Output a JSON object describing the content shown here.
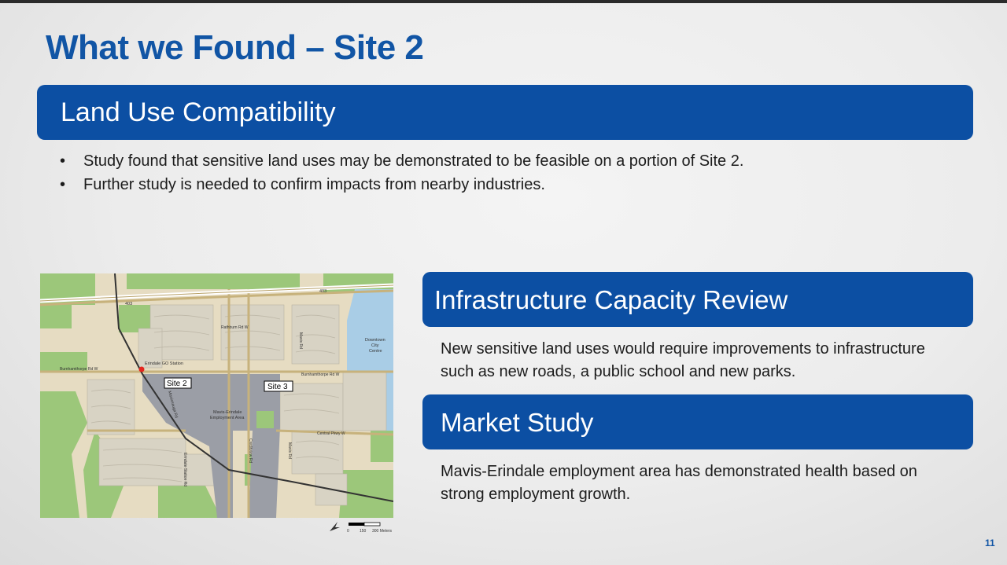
{
  "slide": {
    "title": "What we Found – Site 2",
    "page_number": "11"
  },
  "land_use": {
    "heading": "Land Use Compatibility",
    "bullets": [
      "Study found that sensitive land uses may be demonstrated to be feasible on a portion of Site 2.",
      "Further study is needed to confirm impacts from nearby industries."
    ]
  },
  "infrastructure": {
    "heading": "Infrastructure Capacity Review",
    "text": "New sensitive land uses would require improvements to infrastructure such as new roads, a public school and new parks."
  },
  "market": {
    "heading": "Market Study",
    "text": "Mavis-Erindale employment area has demonstrated health based on strong employment growth."
  },
  "map": {
    "labels": {
      "site2": "Site 2",
      "site3": "Site 3",
      "station": "Erindale GO Station",
      "employment_line1": "Mavis-Erindale",
      "employment_line2": "Employment Area",
      "downtown_line1": "Downtown",
      "downtown_line2": "City",
      "downtown_line3": "Centre",
      "hwy": "403",
      "hwy2": "403",
      "rathburn": "Rathburn Rd W",
      "burnhamthorpe_w": "Burnhamthorpe Rd W",
      "burnhamthorpe_e": "Burnhamthorpe Rd W",
      "central": "Central Pkwy W",
      "mavis": "Mavis Rd",
      "mavis2": "Mavis Rd",
      "creditview": "Creditview Rd",
      "erindale": "Erindale Station Rd",
      "mississauga": "Mississauga Rd"
    },
    "scale": {
      "t0": "0",
      "t1": "150",
      "t2": "300 Meters"
    },
    "colors": {
      "green": "#9cc77a",
      "residential": "#d8d3c4",
      "employment": "#9b9ea6",
      "water": "#a9cde6",
      "station": "#e4261e"
    }
  }
}
